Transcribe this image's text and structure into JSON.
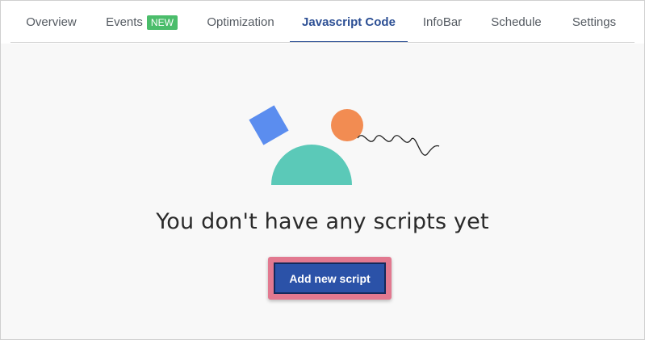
{
  "tabs": [
    {
      "label": "Overview"
    },
    {
      "label": "Events",
      "badge": "NEW"
    },
    {
      "label": "Optimization"
    },
    {
      "label": "Javascript Code",
      "active": true
    },
    {
      "label": "InfoBar"
    },
    {
      "label": "Schedule"
    },
    {
      "label": "Settings"
    }
  ],
  "empty_state": {
    "title": "You don't have any scripts yet",
    "button_label": "Add new script"
  },
  "colors": {
    "accent": "#2c4f94",
    "badge": "#4bbd6b",
    "button": "#2b52a8",
    "highlight": "#e27990",
    "square": "#5b8def",
    "circle": "#f28c52",
    "semicircle": "#5bc9b8"
  }
}
